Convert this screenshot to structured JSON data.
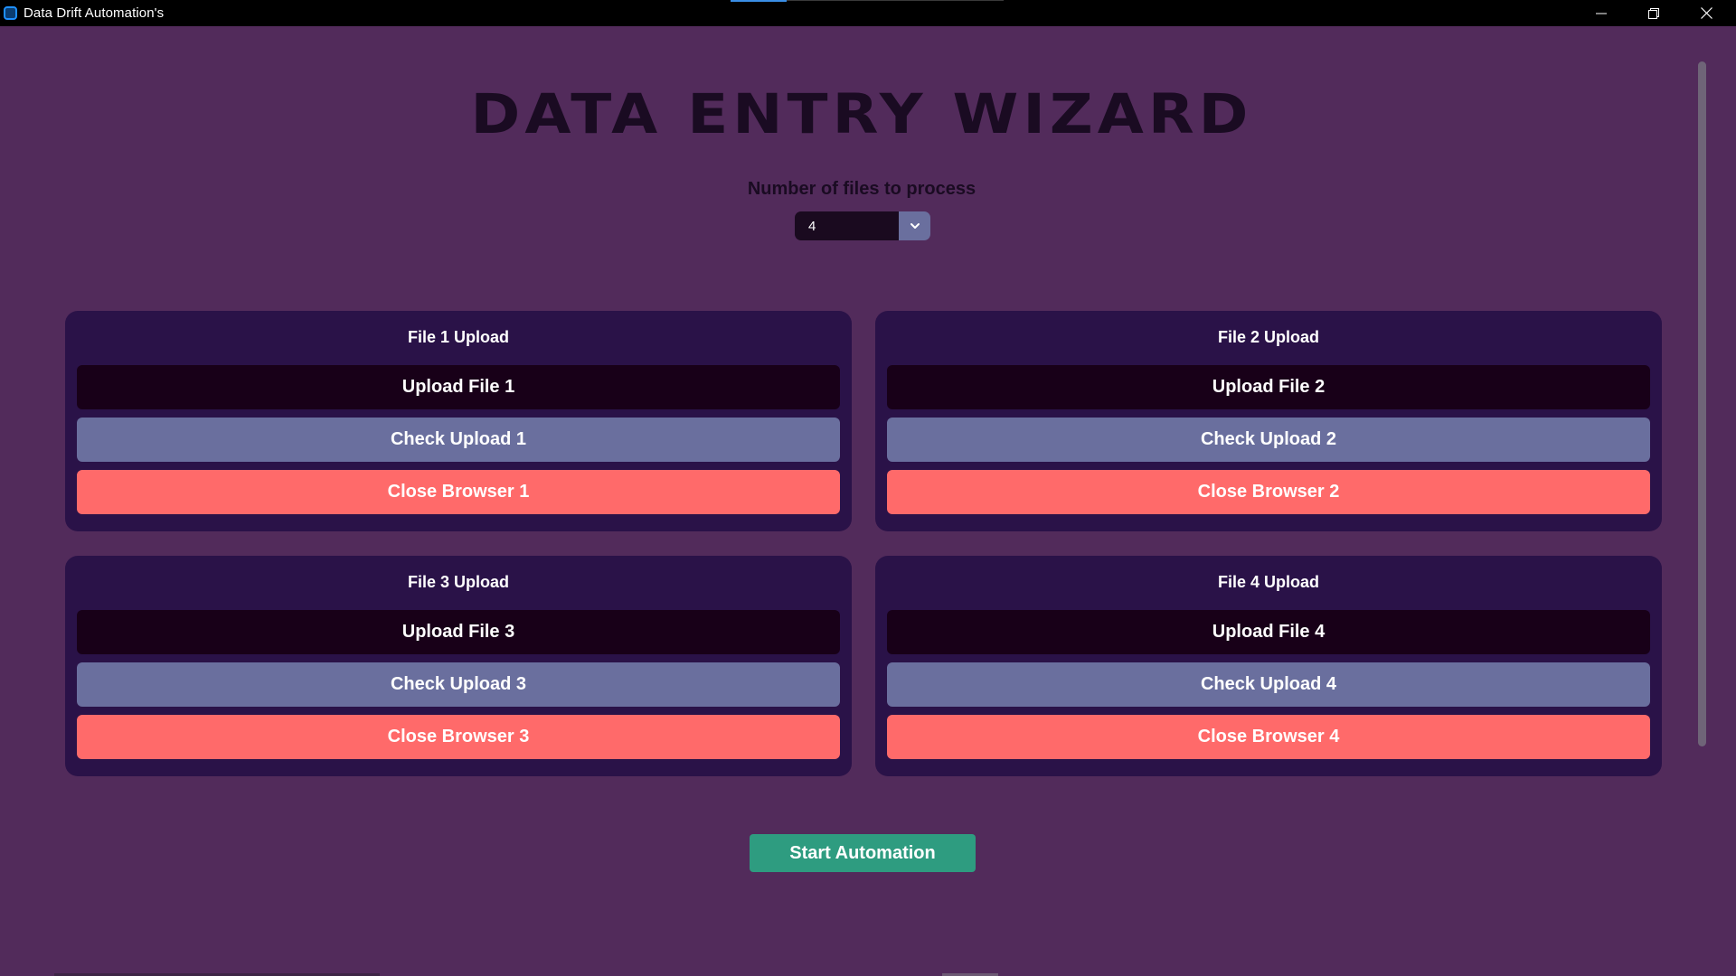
{
  "window": {
    "title": "Data Drift Automation's",
    "controls": {
      "minimize_icon": "minimize-icon",
      "restore_icon": "restore-icon",
      "close_icon": "close-icon"
    }
  },
  "header": {
    "title": "DATA ENTRY WIZARD",
    "count_label": "Number of files to process",
    "count_value": "4"
  },
  "cards": [
    {
      "title": "File 1 Upload",
      "upload": "Upload File 1",
      "check": "Check Upload 1",
      "close": "Close Browser 1"
    },
    {
      "title": "File 2 Upload",
      "upload": "Upload File 2",
      "check": "Check Upload 2",
      "close": "Close Browser 2"
    },
    {
      "title": "File 3 Upload",
      "upload": "Upload File 3",
      "check": "Check Upload 3",
      "close": "Close Browser 3"
    },
    {
      "title": "File 4 Upload",
      "upload": "Upload File 4",
      "check": "Check Upload 4",
      "close": "Close Browser 4"
    }
  ],
  "footer": {
    "start_label": "Start Automation"
  },
  "colors": {
    "background": "#522b5b",
    "card": "#2a1248",
    "upload_button": "#180018",
    "check_button": "#6a6f9e",
    "close_button": "#ff6a6a",
    "start_button": "#2e9c80"
  }
}
